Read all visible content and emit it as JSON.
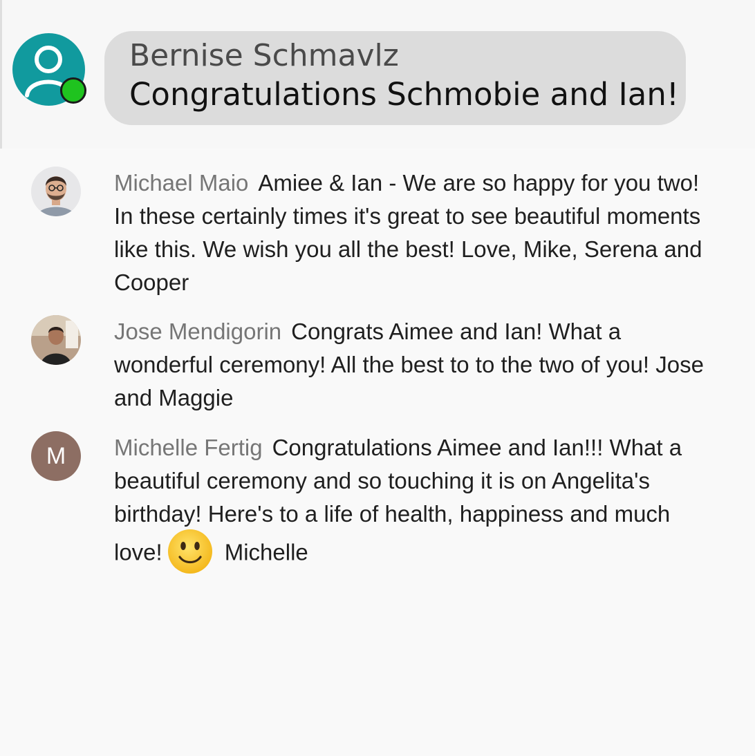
{
  "header_message": {
    "sender": "Bernise Schmavlz",
    "text": "Congratulations Schmobie and Ian!",
    "avatar_icon": "person-icon",
    "presence": "online",
    "colors": {
      "avatar": "#119a9e",
      "presence": "#1fc31f",
      "bubble": "#dcdcdc"
    }
  },
  "messages": [
    {
      "author": "Michael Maio",
      "text": "Amiee & Ian - We are so happy for you two! In these certainly times it's great to see beautiful moments like this. We wish you all the best! Love, Mike, Serena and Cooper",
      "avatar": "photo"
    },
    {
      "author": "Jose Mendigorin",
      "text": "Congrats Aimee and Ian! What a wonderful ceremony! All the best to to the two of you! Jose and Maggie",
      "avatar": "photo"
    },
    {
      "author": "Michelle Fertig",
      "text_before_emoji": "Congratulations Aimee and Ian!!! What a beautiful ceremony and so touching it is on Angelita's birthday! Here's to a life of health, happiness and much love!",
      "emoji": "slightly-smiling-face-icon",
      "text_after_emoji": "Michelle",
      "avatar": "initial",
      "avatar_initial": "M",
      "avatar_color": "#8d6e63"
    }
  ]
}
